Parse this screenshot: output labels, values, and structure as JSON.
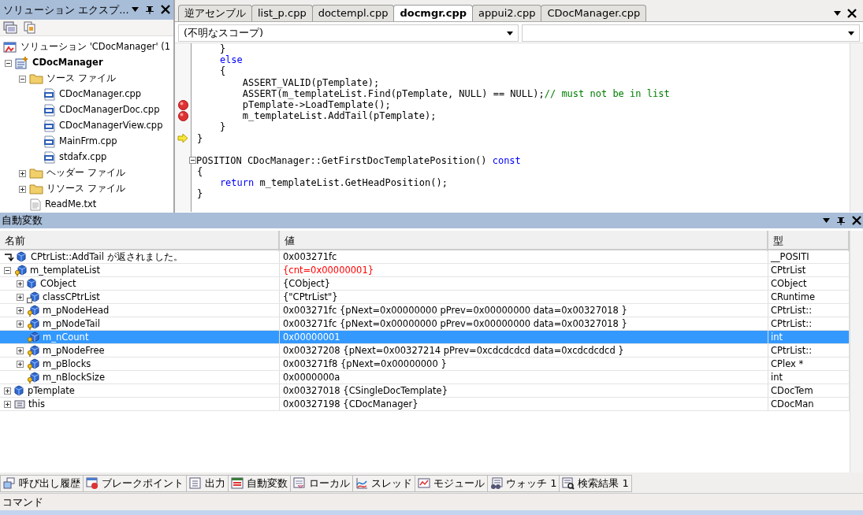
{
  "solution_explorer": {
    "title": "ソリューション エクスプ...",
    "tree": [
      {
        "label": "ソリューション 'CDocManager' (1",
        "kind": "solution",
        "children": [
          {
            "label": "CDocManager",
            "kind": "project",
            "expanded": true,
            "children": [
              {
                "label": "ソース ファイル",
                "kind": "folder",
                "expanded": true,
                "children": [
                  {
                    "label": "CDocManager.cpp",
                    "kind": "cpp"
                  },
                  {
                    "label": "CDocManagerDoc.cpp",
                    "kind": "cpp"
                  },
                  {
                    "label": "CDocManagerView.cpp",
                    "kind": "cpp"
                  },
                  {
                    "label": "MainFrm.cpp",
                    "kind": "cpp"
                  },
                  {
                    "label": "stdafx.cpp",
                    "kind": "cpp"
                  }
                ]
              },
              {
                "label": "ヘッダー ファイル",
                "kind": "folder",
                "expanded": false
              },
              {
                "label": "リソース ファイル",
                "kind": "folder",
                "expanded": false
              },
              {
                "label": "ReadMe.txt",
                "kind": "text"
              }
            ]
          }
        ]
      }
    ]
  },
  "editor": {
    "tabs": [
      {
        "label": "逆アセンブル",
        "selected": false
      },
      {
        "label": "list_p.cpp",
        "selected": false
      },
      {
        "label": "doctempl.cpp",
        "selected": false
      },
      {
        "label": "docmgr.cpp",
        "selected": true
      },
      {
        "label": "appui2.cpp",
        "selected": false
      },
      {
        "label": "CDocManager.cpp",
        "selected": false
      }
    ],
    "scope": {
      "value": "(不明なスコープ)"
    },
    "lines": [
      {
        "tokens": [
          {
            "text": "    }",
            "kind": "plain"
          }
        ]
      },
      {
        "tokens": [
          {
            "text": "    else",
            "kind": "keyword"
          }
        ]
      },
      {
        "tokens": [
          {
            "text": "    {",
            "kind": "plain"
          }
        ]
      },
      {
        "tokens": [
          {
            "text": "        ASSERT_VALID(pTemplate);",
            "kind": "plain"
          }
        ]
      },
      {
        "tokens": [
          {
            "text": "        ASSERT(m_templateList.Find(pTemplate, NULL) == NULL);",
            "kind": "plain"
          },
          {
            "text": "// must not be in list",
            "kind": "comment"
          }
        ]
      },
      {
        "breakpoint": true,
        "tokens": [
          {
            "text": "        pTemplate->LoadTemplate();",
            "kind": "plain"
          }
        ]
      },
      {
        "breakpoint": true,
        "tokens": [
          {
            "text": "        m_templateList.AddTail(pTemplate);",
            "kind": "plain"
          }
        ]
      },
      {
        "tokens": [
          {
            "text": "    }",
            "kind": "plain"
          }
        ]
      },
      {
        "current": true,
        "tokens": [
          {
            "text": "}",
            "kind": "plain"
          }
        ]
      },
      {
        "gap_before": true,
        "fold": true,
        "tokens": [
          {
            "text": "POSITION CDocManager::GetFirstDocTemplatePosition() ",
            "kind": "plain"
          },
          {
            "text": "const",
            "kind": "keyword"
          }
        ]
      },
      {
        "tokens": [
          {
            "text": "{",
            "kind": "plain"
          }
        ]
      },
      {
        "tokens": [
          {
            "text": "    return",
            "kind": "keyword"
          },
          {
            "text": " m_templateList.GetHeadPosition();",
            "kind": "plain"
          }
        ]
      },
      {
        "tokens": [
          {
            "text": "}",
            "kind": "plain"
          }
        ]
      }
    ]
  },
  "autos": {
    "title": "自動変数",
    "columns": [
      "名前",
      "値",
      "型"
    ],
    "rows": [
      {
        "name": "CPtrList::AddTail が返されました。",
        "value": "0x003271fc",
        "type": "__POSITI",
        "kind": "return",
        "selected": false
      },
      {
        "name": "m_templateList",
        "value": "{cnt=0x00000001}",
        "type": "CPtrList",
        "kind": "member",
        "changed": true,
        "expanded": true,
        "selected": false,
        "children": [
          {
            "name": "CObject",
            "value": "{CObject}",
            "type": "CObject",
            "kind": "base",
            "expanded": false,
            "selected": false
          },
          {
            "name": "classCPtrList",
            "value": "{\"CPtrList\"}",
            "type": "CRuntime",
            "kind": "static",
            "expanded": false,
            "selected": false
          },
          {
            "name": "m_pNodeHead",
            "value": "0x003271fc {pNext=0x00000000 pPrev=0x00000000 data=0x00327018 }",
            "type": "CPtrList::",
            "kind": "member",
            "expanded": false,
            "selected": false
          },
          {
            "name": "m_pNodeTail",
            "value": "0x003271fc {pNext=0x00000000 pPrev=0x00000000 data=0x00327018 }",
            "type": "CPtrList::",
            "kind": "member",
            "expanded": false,
            "selected": false
          },
          {
            "name": "m_nCount",
            "value": "0x00000001",
            "type": "int",
            "kind": "member",
            "selected": true
          },
          {
            "name": "m_pNodeFree",
            "value": "0x00327208 {pNext=0x00327214 pPrev=0xcdcdcdcd data=0xcdcdcdcd }",
            "type": "CPtrList::",
            "kind": "member",
            "expanded": false,
            "selected": false
          },
          {
            "name": "m_pBlocks",
            "value": "0x003271f8 {pNext=0x00000000 }",
            "type": "CPlex *",
            "kind": "member",
            "expanded": false,
            "selected": false
          },
          {
            "name": "m_nBlockSize",
            "value": "0x0000000a",
            "type": "int",
            "kind": "member",
            "selected": false
          }
        ]
      },
      {
        "name": "pTemplate",
        "value": "0x00327018 {CSingleDocTemplate}",
        "type": "CDocTem",
        "kind": "base",
        "expanded": false,
        "selected": false
      },
      {
        "name": "this",
        "value": "0x00327198 {CDocManager}",
        "type": "CDocMan",
        "kind": "local",
        "expanded": false,
        "selected": false
      }
    ]
  },
  "bottom_tabs": [
    {
      "label": "呼び出し履歴",
      "selected": false
    },
    {
      "label": "ブレークポイント",
      "selected": false
    },
    {
      "label": "出力",
      "selected": false
    },
    {
      "label": "自動変数",
      "selected": false
    },
    {
      "label": "ローカル",
      "selected": false
    },
    {
      "label": "スレッド",
      "selected": false
    },
    {
      "label": "モジュール",
      "selected": false
    },
    {
      "label": "ウォッチ 1",
      "selected": false
    },
    {
      "label": "検索結果 1",
      "selected": false
    }
  ],
  "command_bar": {
    "label": "コマンド"
  }
}
